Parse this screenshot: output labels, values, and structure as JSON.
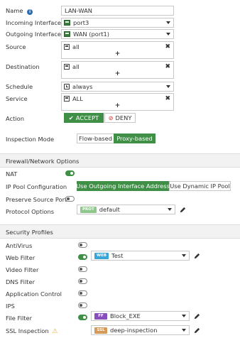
{
  "policy": {
    "name_label": "Name",
    "name_value": "LAN-WAN",
    "incoming_label": "Incoming Interface",
    "incoming_value": "port3",
    "outgoing_label": "Outgoing Interface",
    "outgoing_value": "WAN (port1)",
    "source_label": "Source",
    "source_value": "all",
    "destination_label": "Destination",
    "destination_value": "all",
    "schedule_label": "Schedule",
    "schedule_value": "always",
    "service_label": "Service",
    "service_value": "ALL",
    "action_label": "Action",
    "accept_label": "ACCEPT",
    "deny_label": "DENY",
    "add_symbol": "+",
    "remove_symbol": "✖",
    "inspection_label": "Inspection Mode",
    "flow_label": "Flow-based",
    "proxy_label": "Proxy-based"
  },
  "firewall": {
    "header": "Firewall/Network Options",
    "nat_label": "NAT",
    "nat_on": true,
    "ippool_label": "IP Pool Configuration",
    "ippool_opt1": "Use Outgoing Interface Address",
    "ippool_opt2": "Use Dynamic IP Pool",
    "preserve_label": "Preserve Source Port",
    "preserve_on": false,
    "protocol_label": "Protocol Options",
    "protocol_badge": "PROT",
    "protocol_value": "default"
  },
  "security": {
    "header": "Security Profiles",
    "antivirus_label": "AntiVirus",
    "webfilter_label": "Web Filter",
    "webfilter_badge": "WEB",
    "webfilter_value": "Test",
    "videofilter_label": "Video Filter",
    "dnsfilter_label": "DNS Filter",
    "appcontrol_label": "Application Control",
    "ips_label": "IPS",
    "filefilter_label": "File Filter",
    "filefilter_badge": "FF",
    "filefilter_value": "Block_EXE",
    "ssl_label": "SSL Inspection",
    "ssl_badge": "SSL",
    "ssl_value": "deep-inspection"
  },
  "colors": {
    "accent_green": "#3f8f46",
    "deny_red": "#d9534f",
    "info_blue": "#2c6cb0",
    "web_badge": "#3aa4d6",
    "ff_badge": "#8a4fbf",
    "ssl_badge": "#d49a5a",
    "prot_badge": "#8ec88c",
    "warning": "#f0ad1e"
  }
}
